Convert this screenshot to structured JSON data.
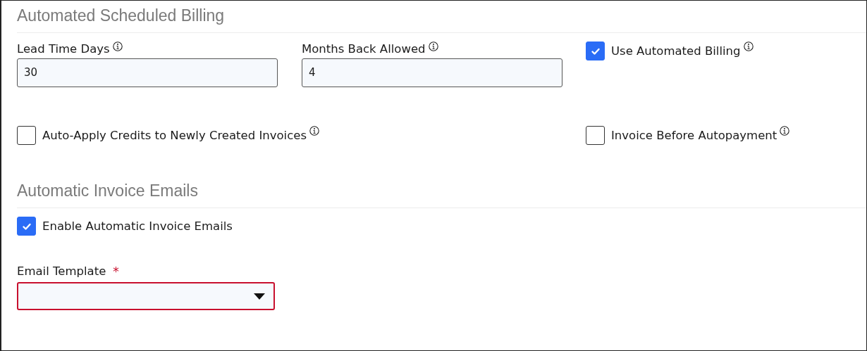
{
  "sections": [
    {
      "title": "Automated Scheduled Billing",
      "rows": [
        [
          {
            "kind": "text",
            "label": "Lead Time Days",
            "info": true,
            "value": "30"
          },
          {
            "kind": "text",
            "label": "Months Back Allowed",
            "info": true,
            "value": "4"
          },
          {
            "kind": "checkbox",
            "label": "Use Automated Billing",
            "info": true,
            "checked": true
          }
        ],
        [
          {
            "kind": "checkbox",
            "label": "Auto-Apply Credits to Newly Created Invoices",
            "info": true,
            "checked": false
          },
          "",
          {
            "kind": "checkbox",
            "label": "Invoice Before Autopayment",
            "info": true,
            "checked": false
          }
        ]
      ]
    },
    {
      "title": "Automatic Invoice Emails",
      "rows": [
        [
          {
            "kind": "checkbox",
            "label": "Enable Automatic Invoice Emails",
            "checked": true
          }
        ],
        [
          {
            "kind": "select",
            "label": "Email Template",
            "required_mark": "*",
            "invalid": true
          }
        ]
      ]
    }
  ]
}
